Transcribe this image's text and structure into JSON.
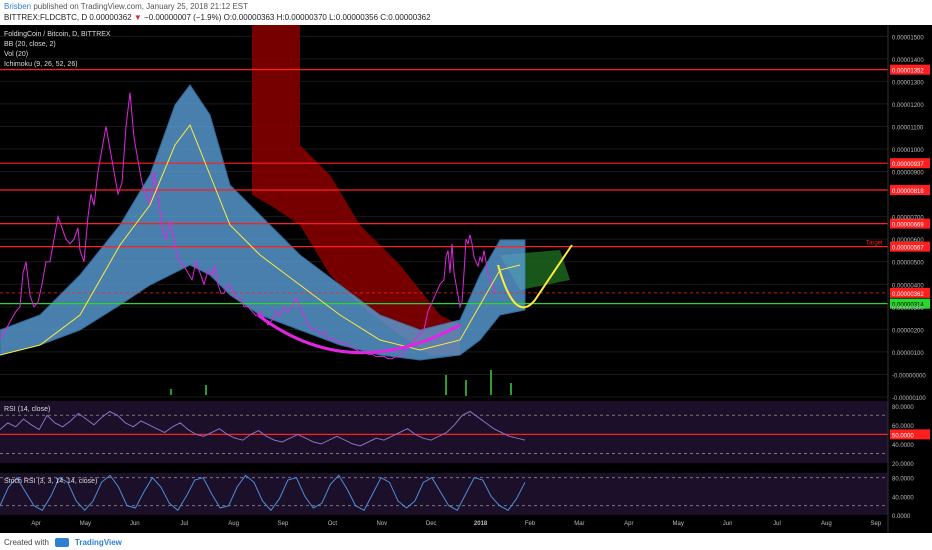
{
  "header": {
    "author": "Brisben",
    "published_text": "published on TradingView.com, January 25, 2018 21:12 EST",
    "symbol_line": "BITTREX:FLDCBTC, D",
    "last": "0.00000362",
    "change": "−0.00000007 (−1.9%)",
    "open": "O:0.00000363",
    "high": "H:0.00000370",
    "low": "L:0.00000356",
    "close": "C:0.00000362"
  },
  "legend": {
    "title": "FoldingCoin / Bitcoin, D, BITTREX",
    "bb": "BB (20, close, 2)",
    "vol": "Vol (20)",
    "ichimoku": "Ichimoku (9, 26, 52, 26)",
    "rsi": "RSI (14, close)",
    "stoch": "Stoch RSI (3, 3, 14, 14, close)"
  },
  "footer": {
    "created_with": "Created with",
    "brand": "TradingView"
  },
  "colors": {
    "background": "#000000",
    "price_line": "#e026e0",
    "bb_fill": "#5a9fd8",
    "bb_line": "#3d84c6",
    "cloud_bear": "#8b0000",
    "cloud_bull": "#1f6b1f",
    "yellow": "#ffeb3b",
    "resistance": "#ff1f1f",
    "support": "#28d828",
    "volume": "#2e9c2e",
    "panel_bg": "#1b0f2a"
  },
  "chart_data": {
    "type": "line",
    "title": "FoldingCoin / Bitcoin, D, BITTREX",
    "x_ticks": [
      "Apr",
      "May",
      "Jun",
      "Jul",
      "Aug",
      "Sep",
      "Oct",
      "Nov",
      "Dec",
      "2018",
      "Feb",
      "Mar",
      "Apr",
      "May",
      "Jun",
      "Jul",
      "Aug",
      "Sep"
    ],
    "y_ticks": [
      "0.00001500",
      "0.00001400",
      "0.00001300",
      "0.00001200",
      "0.00001100",
      "0.00001000",
      "0.00000900",
      "0.00000700",
      "0.00000600",
      "0.00000500",
      "0.00000400",
      "0.00000300",
      "0.00000200",
      "0.00000100",
      "-0.00000000",
      "-0.00000100"
    ],
    "ylim": [
      -1e-06,
      1.55e-05
    ],
    "price_series": {
      "name": "FLDCBTC",
      "x": [
        0,
        6,
        12,
        16,
        20,
        23,
        26,
        30,
        34,
        38,
        42,
        46,
        50,
        54,
        58,
        62,
        66,
        70,
        74,
        78,
        80,
        84,
        86,
        88,
        91,
        94,
        98,
        102,
        106,
        110,
        114,
        118,
        122,
        126,
        130,
        134,
        138,
        142,
        146,
        150,
        154,
        158,
        162,
        166,
        170,
        174,
        176,
        178,
        180,
        184,
        188,
        192,
        196,
        200,
        204,
        208,
        212,
        215,
        218,
        221,
        224,
        228,
        232,
        236,
        240,
        244,
        248,
        252,
        256,
        260,
        264,
        268,
        272,
        276,
        280,
        284,
        288,
        292,
        296,
        300,
        304,
        308,
        312,
        316,
        320,
        324,
        328,
        332,
        336,
        340,
        344,
        348,
        352,
        356,
        360,
        364,
        368,
        372,
        376,
        380,
        384,
        388,
        392,
        396,
        400,
        404,
        408,
        412,
        416,
        420,
        424,
        428,
        432,
        436,
        440,
        444,
        446,
        448,
        450,
        452,
        454,
        456,
        458,
        460,
        462,
        464,
        466,
        468,
        470,
        472,
        474,
        476,
        478,
        480,
        482,
        484,
        486,
        488,
        490,
        492,
        494,
        496,
        498
      ],
      "y": [
        1.6e-06,
        2e-06,
        2.5e-06,
        2.8e-06,
        3e-06,
        4.5e-06,
        5e-06,
        3.5e-06,
        3e-06,
        3.2e-06,
        4e-06,
        5e-06,
        5e-06,
        6e-06,
        7e-06,
        6.5e-06,
        6e-06,
        5.8e-06,
        6e-06,
        6.5e-06,
        5.5e-06,
        5e-06,
        6e-06,
        7e-06,
        8e-06,
        7.5e-06,
        9e-06,
        1e-05,
        1.1e-05,
        1e-05,
        9e-06,
        8e-06,
        8.5e-06,
        1.1e-05,
        1.25e-05,
        1.05e-05,
        9.5e-06,
        8.5e-06,
        8e-06,
        7.5e-06,
        9e-06,
        8e-06,
        6.5e-06,
        6e-06,
        6.8e-06,
        6e-06,
        5.5e-06,
        5.2e-06,
        5e-06,
        4.8e-06,
        4.5e-06,
        4.2e-06,
        5e-06,
        4.5e-06,
        4e-06,
        4.6e-06,
        4.4e-06,
        4.8e-06,
        4e-06,
        3.6e-06,
        3.6e-06,
        4e-06,
        3.8e-06,
        3.4e-06,
        3.4e-06,
        3e-06,
        3e-06,
        2.8e-06,
        2.6e-06,
        2.8e-06,
        2.5e-06,
        2.2e-06,
        2.4e-06,
        2.8e-06,
        2.6e-06,
        3e-06,
        2.8e-06,
        3e-06,
        3.4e-06,
        3e-06,
        2.6e-06,
        2.2e-06,
        2e-06,
        2e-06,
        1.8e-06,
        1.9e-06,
        1.6e-06,
        1.6e-06,
        1.5e-06,
        1.4e-06,
        1.4e-06,
        1.3e-06,
        1.2e-06,
        1.1e-06,
        1e-06,
        1e-06,
        9e-07,
        9e-07,
        8e-07,
        8e-07,
        8e-07,
        7e-07,
        7e-07,
        8e-07,
        8e-07,
        1e-06,
        1.2e-06,
        1.4e-06,
        1.6e-06,
        1.8e-06,
        2e-06,
        2.8e-06,
        3.2e-06,
        3.6e-06,
        4e-06,
        4.2e-06,
        5.2e-06,
        5.5e-06,
        4.5e-06,
        5.8e-06,
        4.5e-06,
        4e-06,
        3.5e-06,
        3e-06,
        3.2e-06,
        4.5e-06,
        6e-06,
        5.8e-06,
        6.2e-06,
        5.8e-06,
        5.2e-06,
        5e-06,
        4.8e-06,
        5.2e-06,
        5e-06,
        5.5e-06,
        5e-06,
        4.5e-06,
        4.2e-06,
        4e-06,
        3.8e-06,
        3.6e-06
      ]
    },
    "levels": [
      {
        "value": 1.352e-05,
        "label": "0.00001352",
        "kind": "resistance"
      },
      {
        "value": 9.37e-06,
        "label": "0.00000937",
        "kind": "resistance"
      },
      {
        "value": 8.18e-06,
        "label": "0.00000818",
        "kind": "resistance"
      },
      {
        "value": 6.69e-06,
        "label": "0.00000669",
        "kind": "resistance"
      },
      {
        "value": 5.67e-06,
        "label": "0.00000567",
        "kind": "resistance"
      },
      {
        "value": 3.62e-06,
        "label": "0.00000362",
        "kind": "last"
      },
      {
        "value": 3.14e-06,
        "label": "0.00000314",
        "kind": "support"
      }
    ],
    "annotation": "Target",
    "rsi": {
      "y_ticks": [
        "80.0000",
        "60.0000",
        "50.0000",
        "40.0000",
        "20.0000"
      ],
      "ylim": [
        20,
        85
      ],
      "highlight_label": "50.0000",
      "values": [
        55,
        62,
        58,
        66,
        60,
        55,
        70,
        62,
        58,
        64,
        72,
        66,
        60,
        68,
        74,
        70,
        62,
        58,
        64,
        60,
        56,
        52,
        58,
        62,
        55,
        50,
        48,
        52,
        56,
        50,
        46,
        44,
        50,
        54,
        48,
        44,
        42,
        46,
        50,
        46,
        42,
        40,
        44,
        48,
        44,
        40,
        38,
        42,
        46,
        44,
        48,
        52,
        56,
        50,
        46,
        44,
        48,
        52,
        60,
        70,
        74,
        68,
        62,
        56,
        52,
        48,
        46,
        44
      ]
    },
    "stoch": {
      "y_ticks": [
        "80.0000",
        "40.0000",
        "0.0000"
      ],
      "ylim": [
        0,
        90
      ],
      "k": [
        20,
        60,
        80,
        50,
        20,
        10,
        40,
        80,
        70,
        30,
        10,
        30,
        70,
        85,
        60,
        20,
        15,
        50,
        80,
        60,
        25,
        10,
        40,
        75,
        80,
        45,
        15,
        20,
        60,
        85,
        70,
        30,
        10,
        35,
        75,
        80,
        40,
        15,
        25,
        65,
        85,
        55,
        20,
        10,
        45,
        80,
        70,
        30,
        15,
        30,
        70,
        80,
        50,
        20,
        10,
        45,
        80,
        75,
        40,
        20,
        10,
        35,
        70
      ]
    }
  }
}
